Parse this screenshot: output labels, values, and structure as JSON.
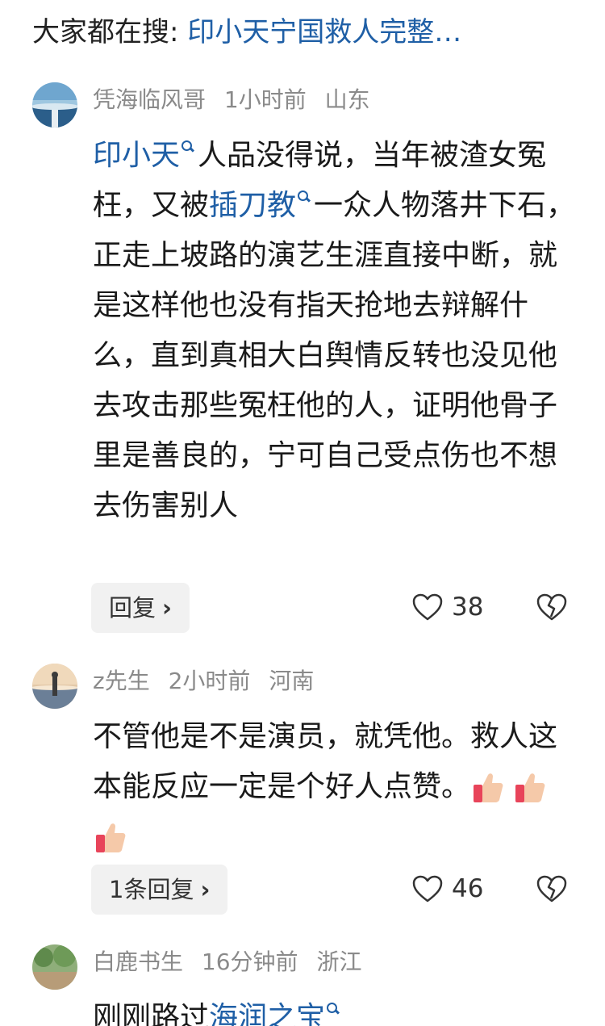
{
  "search": {
    "prefix": "大家都在搜: ",
    "query": "印小天宁国救人完整…"
  },
  "comments": [
    {
      "user": "凭海临风哥",
      "time": "1小时前",
      "location": "山东",
      "link1": "印小天",
      "text1": "人品没得说，当年被渣女冤枉，又被",
      "link2": "插刀教",
      "text2": "一众人物落井下石，正走上坡路的演艺生涯直接中断，就是这样他也没有指天抢地去辩解什么，直到真相大白舆情反转也没见他去攻击那些冤枉他的人，证明他骨子里是善良的，宁可自己受点伤也不想去伤害别人",
      "reply_label": "回复",
      "likes": "38"
    },
    {
      "user": "z先生",
      "time": "2小时前",
      "location": "河南",
      "text": "不管他是不是演员，就凭他。救人这本能反应一定是个好人点赞。",
      "reply_label": "1条回复",
      "likes": "46"
    },
    {
      "user": "白鹿书生",
      "time": "16分钟前",
      "location": "浙江",
      "text_start": "刚刚路过",
      "link": "海润之宝"
    }
  ],
  "icons": {
    "like": "heart-outline-icon",
    "dislike": "broken-heart-icon",
    "search": "magnifier-icon",
    "chevron": "chevron-right-icon",
    "thumb": "thumbs-up-emoji"
  },
  "colors": {
    "link": "#1f5fa6",
    "meta": "#8a8a8a",
    "reply_bg": "#f1f1f1"
  }
}
